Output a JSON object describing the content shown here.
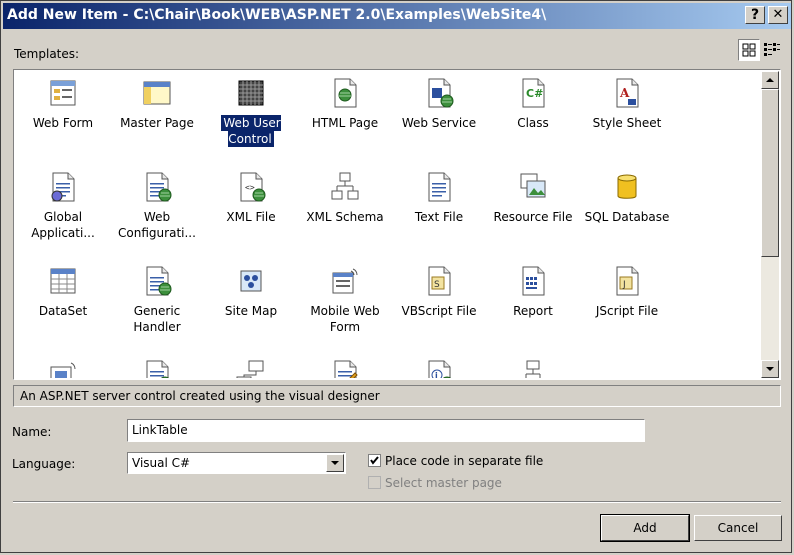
{
  "titlebar": {
    "title": "Add New Item - C:\\Chair\\Book\\WEB\\ASP.NET 2.0\\Examples\\WebSite4\\",
    "help_label": "?",
    "close_label": "✕"
  },
  "templates_label": "Templates:",
  "view_buttons": [
    "large-icons-view",
    "small-icons-view"
  ],
  "templates": [
    {
      "label": "Web Form",
      "icon": "web-form-icon"
    },
    {
      "label": "Master Page",
      "icon": "master-page-icon"
    },
    {
      "label": "Web User Control",
      "icon": "web-user-control-icon",
      "selected": true
    },
    {
      "label": "HTML Page",
      "icon": "html-page-icon"
    },
    {
      "label": "Web Service",
      "icon": "web-service-icon"
    },
    {
      "label": "Class",
      "icon": "class-file-icon"
    },
    {
      "label": "Style Sheet",
      "icon": "style-sheet-icon"
    },
    {
      "label": "Global Applicati...",
      "icon": "global-application-icon"
    },
    {
      "label": "Web Configurati...",
      "icon": "web-configuration-icon"
    },
    {
      "label": "XML File",
      "icon": "xml-file-icon"
    },
    {
      "label": "XML Schema",
      "icon": "xml-schema-icon"
    },
    {
      "label": "Text File",
      "icon": "text-file-icon"
    },
    {
      "label": "Resource File",
      "icon": "resource-file-icon"
    },
    {
      "label": "SQL Database",
      "icon": "sql-database-icon"
    },
    {
      "label": "DataSet",
      "icon": "dataset-icon"
    },
    {
      "label": "Generic Handler",
      "icon": "generic-handler-icon"
    },
    {
      "label": "Site Map",
      "icon": "site-map-icon"
    },
    {
      "label": "Mobile Web Form",
      "icon": "mobile-web-form-icon"
    },
    {
      "label": "VBScript File",
      "icon": "vbscript-file-icon"
    },
    {
      "label": "Report",
      "icon": "report-icon"
    },
    {
      "label": "JScript File",
      "icon": "jscript-file-icon"
    },
    {
      "label": "",
      "icon": "mobile-web-user-control-icon"
    },
    {
      "label": "",
      "icon": "mobile-web-configuration-icon"
    },
    {
      "label": "",
      "icon": "class-diagram-icon"
    },
    {
      "label": "",
      "icon": "skin-file-icon"
    },
    {
      "label": "",
      "icon": "browser-file-icon"
    },
    {
      "label": "",
      "icon": "crystal-report-icon"
    }
  ],
  "description": "An ASP.NET server control created using the visual designer",
  "name_label": "Name:",
  "name_value": "LinkTable",
  "language_label": "Language:",
  "language_value": "Visual C#",
  "place_code_label": "Place code in separate file",
  "place_code_checked": true,
  "master_page_label": "Select master page",
  "master_page_checked": false,
  "add_label": "Add",
  "cancel_label": "Cancel",
  "colors": {
    "title_start": "#0a246a",
    "title_end": "#a6caf0",
    "dialog_bg": "#d4d0c8",
    "selection": "#0a246a"
  }
}
